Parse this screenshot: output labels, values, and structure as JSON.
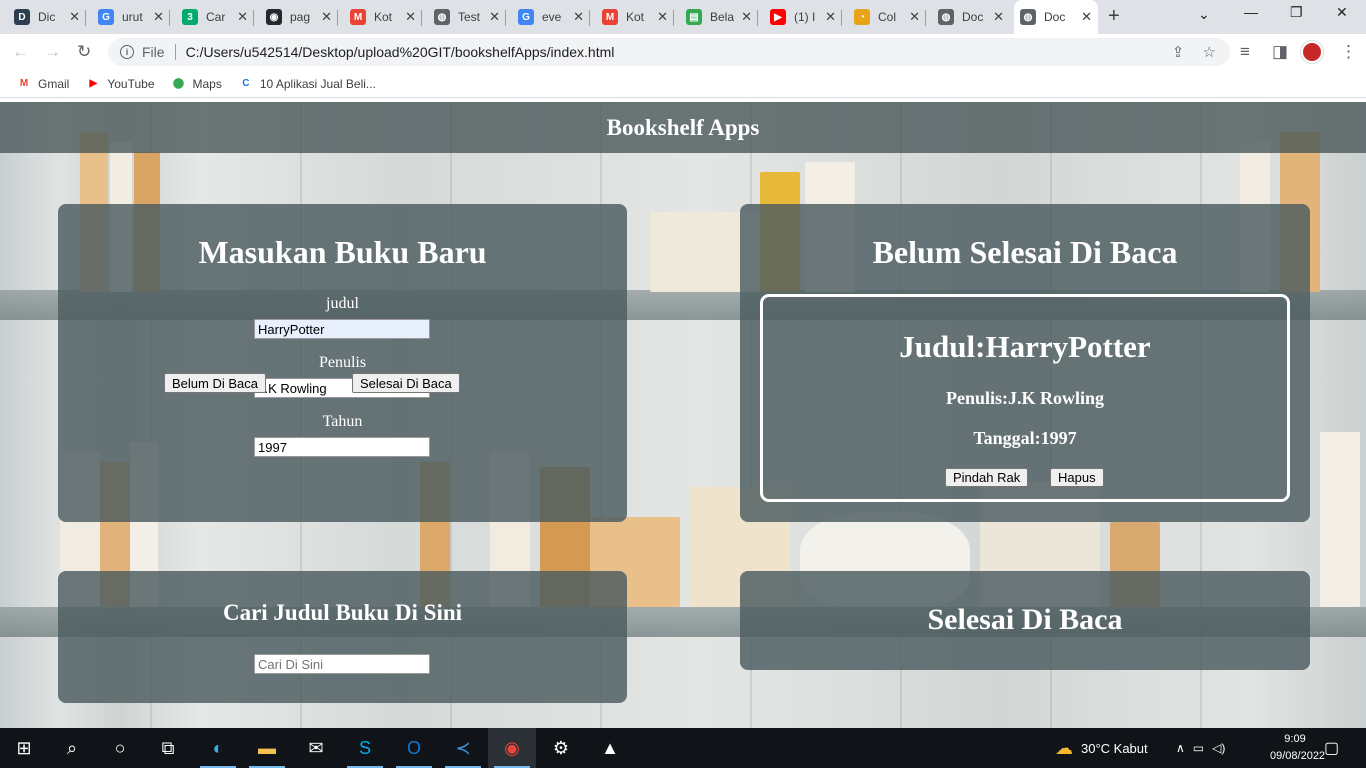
{
  "browser": {
    "tabs": [
      {
        "title": "Dic",
        "icon": "dicoding-icon",
        "color": "#2d3e50",
        "glyph": "D"
      },
      {
        "title": "urut",
        "icon": "google-icon",
        "color": "#4285f4",
        "glyph": "G"
      },
      {
        "title": "Car",
        "icon": "w3schools-icon",
        "color": "#04aa6d",
        "glyph": "3"
      },
      {
        "title": "pag",
        "icon": "github-icon",
        "color": "#24292f",
        "glyph": "◉"
      },
      {
        "title": "Kot",
        "icon": "gmail-icon",
        "color": "#ea4335",
        "glyph": "M"
      },
      {
        "title": "Test",
        "icon": "globe-icon",
        "color": "#5f6368",
        "glyph": "◍"
      },
      {
        "title": "eve",
        "icon": "google-icon",
        "color": "#4285f4",
        "glyph": "G"
      },
      {
        "title": "Kot",
        "icon": "gmail-icon",
        "color": "#ea4335",
        "glyph": "M"
      },
      {
        "title": "Bela",
        "icon": "book-icon",
        "color": "#34a853",
        "glyph": "▤"
      },
      {
        "title": "(1) I",
        "icon": "youtube-icon",
        "color": "#ff0000",
        "glyph": "▶"
      },
      {
        "title": "Col",
        "icon": "tampermonkey-icon",
        "color": "#e8a317",
        "glyph": "◔"
      },
      {
        "title": "Doc",
        "icon": "globe-icon",
        "color": "#5f6368",
        "glyph": "◍"
      },
      {
        "title": "Doc",
        "icon": "globe-icon",
        "color": "#5f6368",
        "glyph": "◍"
      }
    ],
    "close_glyph": "✕",
    "new_tab_glyph": "+",
    "url_scheme": "File",
    "url": "C:/Users/u542514/Desktop/upload%20GIT/bookshelfApps/index.html",
    "bookmarks": [
      {
        "label": "Gmail",
        "icon": "gmail-icon",
        "color": "#ea4335",
        "glyph": "M"
      },
      {
        "label": "YouTube",
        "icon": "youtube-icon",
        "color": "#ff0000",
        "glyph": "▶"
      },
      {
        "label": "Maps",
        "icon": "maps-pin-icon",
        "color": "#34a853",
        "glyph": "⬤"
      },
      {
        "label": "10 Aplikasi Jual Beli...",
        "icon": "site-icon",
        "color": "#1a73e8",
        "glyph": "C"
      }
    ]
  },
  "app": {
    "header_title": "Bookshelf Apps",
    "input_section": {
      "title": "Masukan Buku Baru",
      "title_label": "judul",
      "title_value": "HarryPotter",
      "author_label": "Penulis",
      "author_value": "J.K Rowling",
      "year_label": "Tahun",
      "year_value": "1997",
      "unread_button": "Belum Di Baca",
      "read_button": "Selesai Di Baca"
    },
    "search_section": {
      "title": "Cari Judul Buku Di Sini",
      "placeholder": "Cari Di Sini"
    },
    "unfinished_section": {
      "title": "Belum Selesai Di Baca",
      "books": [
        {
          "title": "Judul:HarryPotter",
          "author": "Penulis:J.K Rowling",
          "year": "Tanggal:1997",
          "move_button": "Pindah Rak",
          "delete_button": "Hapus"
        }
      ]
    },
    "finished_section": {
      "title": "Selesai Di Baca"
    }
  },
  "taskbar": {
    "weather": "30°C  Kabut",
    "time": "9:09",
    "date": "09/08/2022"
  }
}
